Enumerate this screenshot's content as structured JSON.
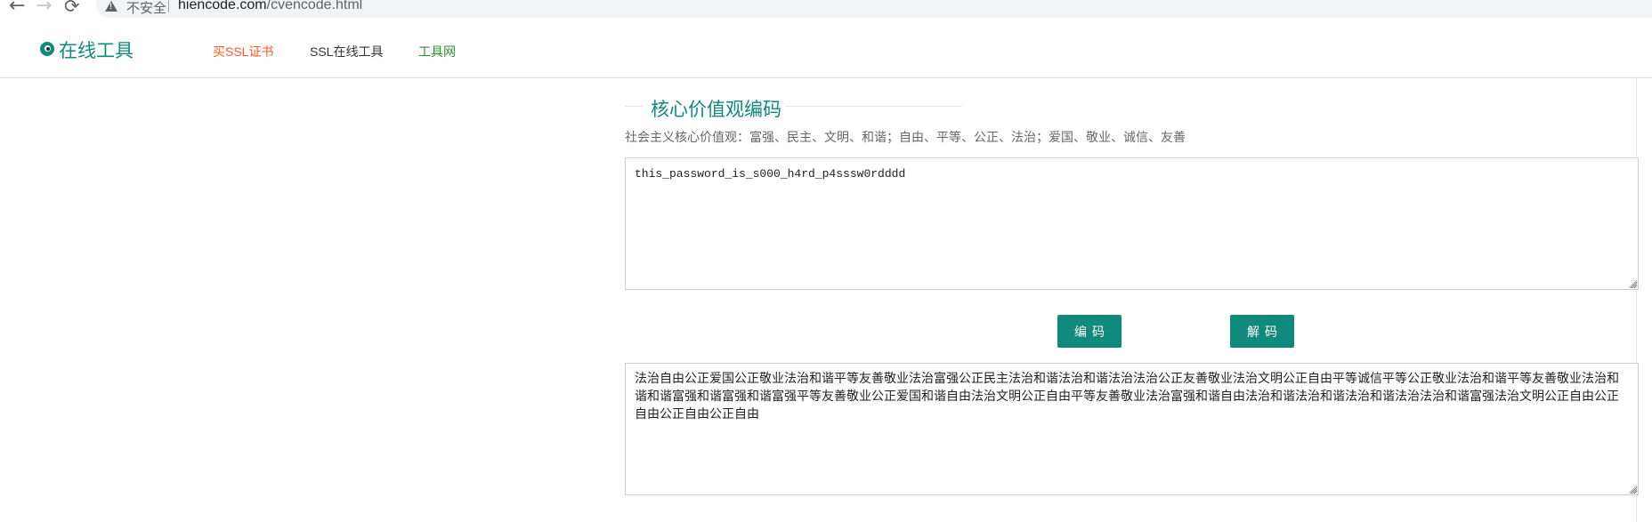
{
  "browser": {
    "back_icon": "←",
    "forward_icon": "→",
    "reload_icon": "⟳",
    "security_label": "不安全",
    "url_host": "hiencode.com",
    "url_path": "/cvencode.html"
  },
  "header": {
    "logo_text": "在线工具",
    "nav": [
      {
        "label": "买SSL证书",
        "color": "#ff5722"
      },
      {
        "label": "SSL在线工具",
        "color": "#333333"
      },
      {
        "label": "工具网",
        "color": "#2e8b2e"
      }
    ]
  },
  "main": {
    "title": "核心价值观编码",
    "subtitle": "社会主义核心价值观：富强、民主、文明、和谐；自由、平等、公正、法治；爱国、敬业、诚信、友善",
    "input_value": "this_password_is_s000_h4rd_p4sssw0rdddd",
    "encode_label": "编码",
    "decode_label": "解码",
    "output_value": "法治自由公正爱国公正敬业法治和谐平等友善敬业法治富强公正民主法治和谐法治和谐法治法治公正友善敬业法治文明公正自由平等诚信平等公正敬业法治和谐平等友善敬业法治和谐和谐富强和谐富强和谐富强平等友善敬业公正爱国和谐自由法治文明公正自由平等友善敬业法治富强和谐自由法治和谐法治和谐法治和谐法治法治和谐富强法治文明公正自由公正自由公正自由公正自由"
  },
  "colors": {
    "accent": "#0f8a7c",
    "ssl_link": "#ff5722",
    "tools_link": "#2e8b2e"
  }
}
